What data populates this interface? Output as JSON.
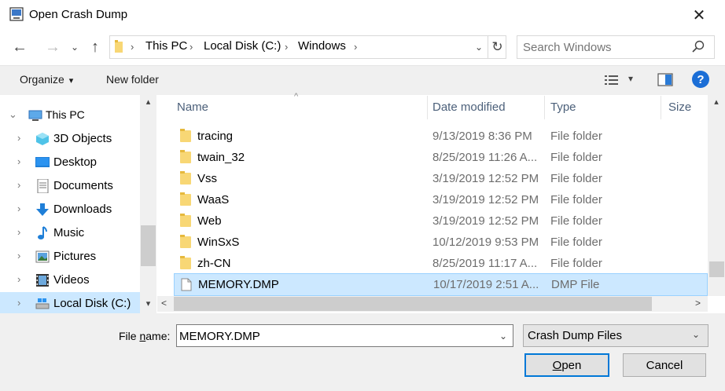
{
  "window": {
    "title": "Open Crash Dump",
    "close_glyph": "✕"
  },
  "nav": {
    "back_glyph": "←",
    "forward_glyph": "→",
    "recent_glyph": "⌄",
    "up_glyph": "↑"
  },
  "address": {
    "crumbs": [
      "This PC",
      "Local Disk (C:)",
      "Windows"
    ],
    "separator": "›",
    "dropdown_glyph": "⌄",
    "refresh_glyph": "↻"
  },
  "search": {
    "placeholder": "Search Windows",
    "icon": "search-icon"
  },
  "toolbar": {
    "organize_label": "Organize",
    "organize_caret": "▾",
    "new_folder_label": "New folder",
    "view_caret": "▾",
    "help_label": "?"
  },
  "sidebar": {
    "items": [
      {
        "label": "This PC",
        "icon": "this-pc-icon",
        "chevron": "⌄"
      },
      {
        "label": "3D Objects",
        "icon": "3d-objects-icon",
        "chevron": "›"
      },
      {
        "label": "Desktop",
        "icon": "desktop-icon",
        "chevron": "›"
      },
      {
        "label": "Documents",
        "icon": "documents-icon",
        "chevron": "›"
      },
      {
        "label": "Downloads",
        "icon": "downloads-icon",
        "chevron": "›"
      },
      {
        "label": "Music",
        "icon": "music-icon",
        "chevron": "›"
      },
      {
        "label": "Pictures",
        "icon": "pictures-icon",
        "chevron": "›"
      },
      {
        "label": "Videos",
        "icon": "videos-icon",
        "chevron": "›"
      },
      {
        "label": "Local Disk (C:)",
        "icon": "local-disk-icon",
        "chevron": "›"
      }
    ],
    "scroll_up_glyph": "▴",
    "scroll_down_glyph": "▾"
  },
  "filelist": {
    "columns": {
      "name": "Name",
      "date": "Date modified",
      "type": "Type",
      "size": "Size"
    },
    "sort_glyph": "^",
    "rows": [
      {
        "name": "tracing",
        "date": "9/13/2019 8:36 PM",
        "type": "File folder",
        "kind": "folder"
      },
      {
        "name": "twain_32",
        "date": "8/25/2019 11:26 A...",
        "type": "File folder",
        "kind": "folder"
      },
      {
        "name": "Vss",
        "date": "3/19/2019 12:52 PM",
        "type": "File folder",
        "kind": "folder"
      },
      {
        "name": "WaaS",
        "date": "3/19/2019 12:52 PM",
        "type": "File folder",
        "kind": "folder"
      },
      {
        "name": "Web",
        "date": "3/19/2019 12:52 PM",
        "type": "File folder",
        "kind": "folder"
      },
      {
        "name": "WinSxS",
        "date": "10/12/2019 9:53 PM",
        "type": "File folder",
        "kind": "folder"
      },
      {
        "name": "zh-CN",
        "date": "8/25/2019 11:17 A...",
        "type": "File folder",
        "kind": "folder"
      },
      {
        "name": "MEMORY.DMP",
        "date": "10/17/2019 2:51 A...",
        "type": "DMP File",
        "kind": "file",
        "selected": true
      }
    ],
    "scroll_up_glyph": "▴",
    "hscroll_left_glyph": "<",
    "hscroll_right_glyph": ">"
  },
  "footer": {
    "filename_label_prefix": "File ",
    "filename_label_ul": "n",
    "filename_label_suffix": "ame:",
    "filename_value": "MEMORY.DMP",
    "filename_dd_glyph": "⌄",
    "filetype_value": "Crash Dump Files",
    "filetype_dd_glyph": "⌄",
    "open_ul": "O",
    "open_rest": "pen",
    "cancel_label": "Cancel"
  },
  "colors": {
    "selection": "#cce8ff",
    "accent": "#0078d7",
    "help": "#1b6ed6"
  }
}
